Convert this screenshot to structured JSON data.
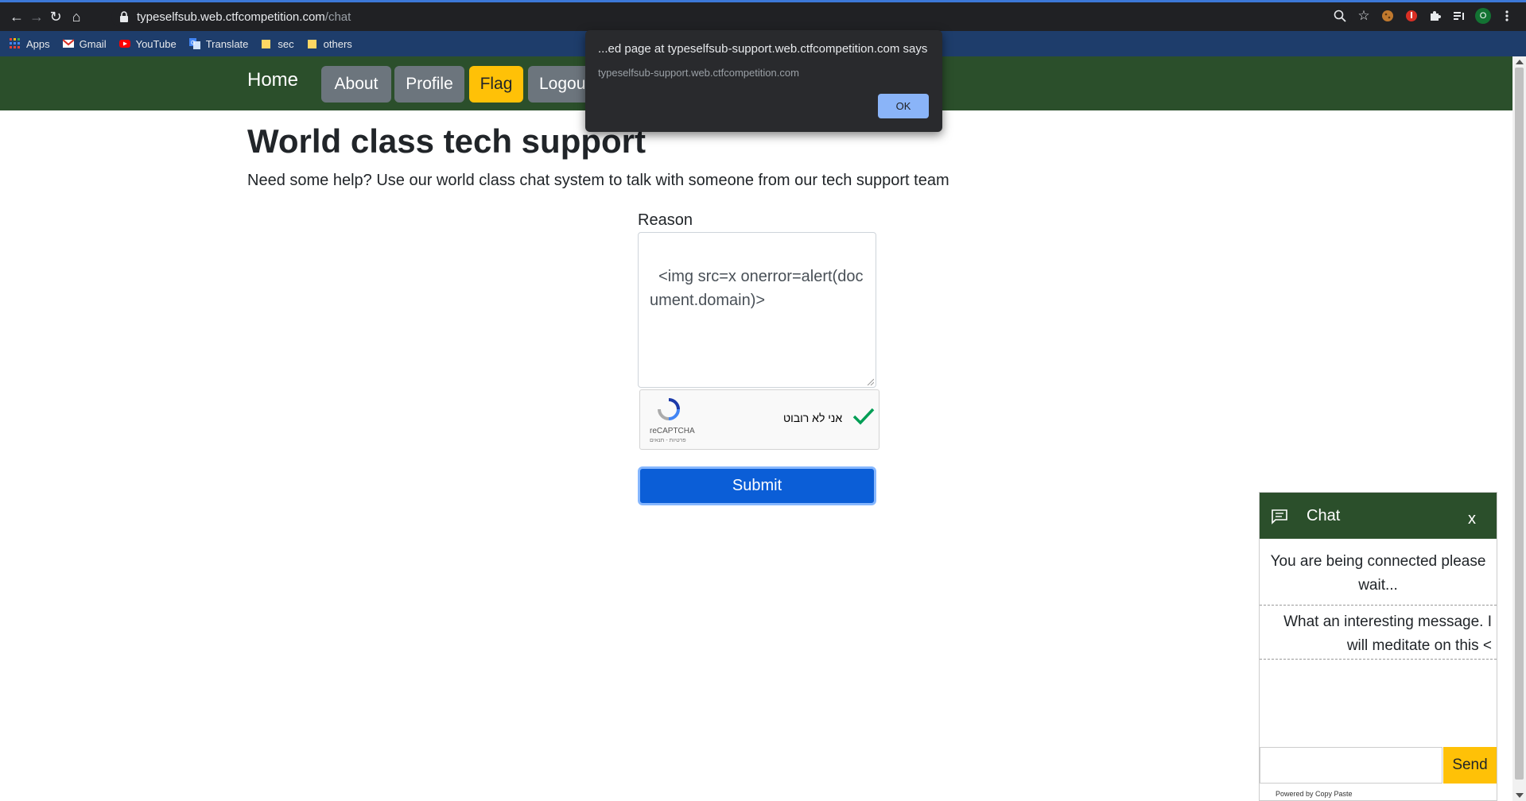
{
  "browser": {
    "url_host": "typeselfsub.web.ctfcompetition.com",
    "url_path": "/chat",
    "profile_initial": "O",
    "bookmarks": [
      "Apps",
      "Gmail",
      "YouTube",
      "Translate",
      "sec",
      "others"
    ]
  },
  "nav": {
    "home": "Home",
    "about": "About",
    "profile": "Profile",
    "flag": "Flag",
    "logout": "Logou"
  },
  "page": {
    "title": "World class tech support",
    "subtitle": "Need some help? Use our world class chat system to talk with someone from our tech support team",
    "reason_label": "Reason",
    "reason_value": "<img src=x onerror=alert(document.domain)>",
    "recaptcha_text": "אני לא רובוט",
    "recaptcha_label": "reCAPTCHA",
    "recaptcha_small": "פרטיות - תנאים",
    "submit": "Submit"
  },
  "dialog": {
    "title": "...ed page at typeselfsub-support.web.ctfcompetition.com says",
    "message": "typeselfsub-support.web.ctfcompetition.com",
    "ok": "OK"
  },
  "chat": {
    "title": "Chat",
    "close": "x",
    "messages": [
      "You are being connected please wait...",
      "What an interesting message. I will meditate on this <"
    ],
    "send": "Send",
    "powered": "Powered by Copy Paste"
  },
  "colors": {
    "navbar": "#2b4f2b",
    "submit": "#0b5ed7",
    "flag": "#ffc107"
  }
}
